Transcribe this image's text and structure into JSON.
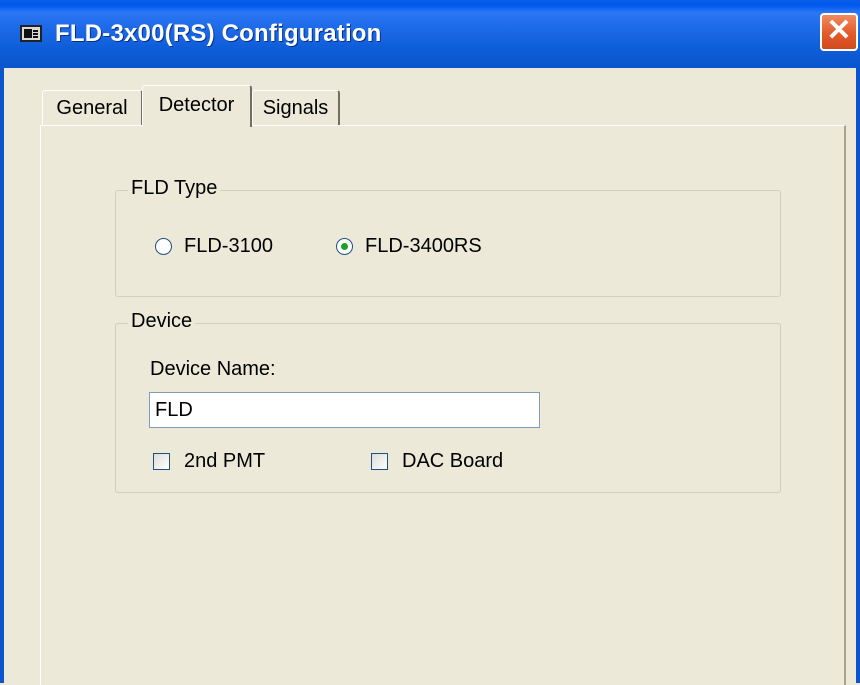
{
  "window": {
    "title": "FLD-3x00(RS) Configuration",
    "close_glyph": "✕"
  },
  "tabs": [
    {
      "label": "General",
      "active": false
    },
    {
      "label": "Detector",
      "active": true
    },
    {
      "label": "Signals",
      "active": false
    }
  ],
  "fld_type": {
    "legend": "FLD Type",
    "options": [
      {
        "label": "FLD-3100",
        "checked": false
      },
      {
        "label": "FLD-3400RS",
        "checked": true
      }
    ]
  },
  "device": {
    "legend": "Device",
    "name_label": "Device Name:",
    "name_value": "FLD",
    "checkboxes": [
      {
        "label": "2nd PMT",
        "checked": false
      },
      {
        "label": "DAC Board",
        "checked": false
      }
    ]
  },
  "colors": {
    "titlebar": "#0a55cc",
    "dialog_bg": "#ece9d8",
    "close_button": "#e35a2a",
    "radio_dot": "#20a020"
  }
}
